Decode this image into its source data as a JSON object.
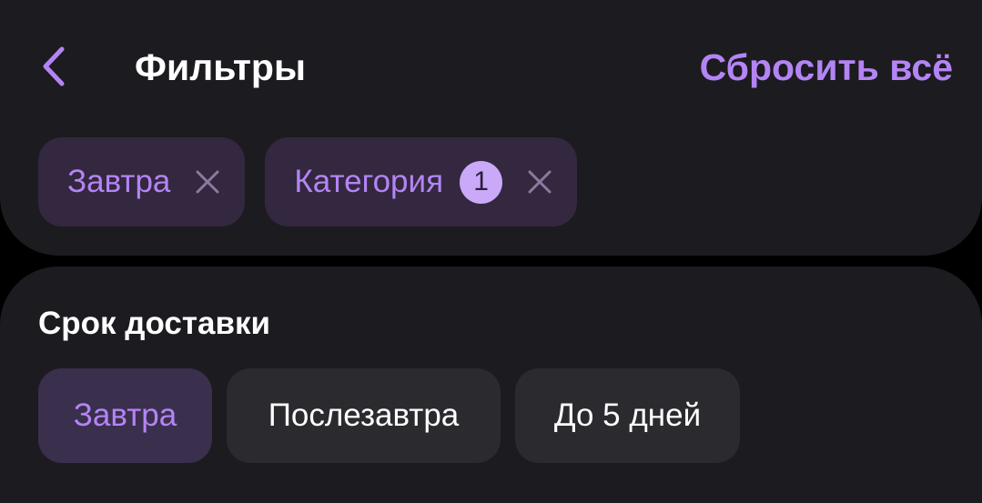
{
  "header": {
    "back_icon": "chevron-left-icon",
    "title": "Фильтры",
    "reset_label": "Сбросить всё"
  },
  "active_filters": [
    {
      "label": "Завтра",
      "remove_icon": "close-icon"
    },
    {
      "label": "Категория",
      "count": "1",
      "remove_icon": "close-icon"
    }
  ],
  "delivery": {
    "title": "Срок доставки",
    "options": [
      {
        "label": "Завтра",
        "selected": true
      },
      {
        "label": "Послезавтра",
        "selected": false
      },
      {
        "label": "До 5 дней",
        "selected": false
      }
    ]
  },
  "colors": {
    "accent": "#b484f5",
    "chip_active_bg": "#33283f",
    "card_bg": "#1c1b1f",
    "background": "#000000"
  }
}
